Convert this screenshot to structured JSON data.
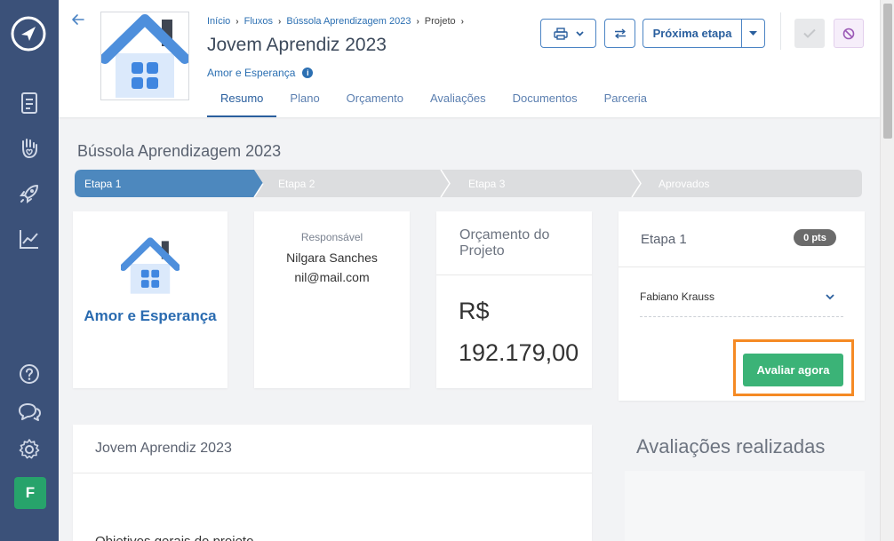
{
  "header": {
    "breadcrumb": [
      "Início",
      "Fluxos",
      "Bússola Aprendizagem 2023",
      "Projeto"
    ],
    "title": "Jovem Aprendiz 2023",
    "organization": "Amor e Esperança",
    "tabs": [
      "Resumo",
      "Plano",
      "Orçamento",
      "Avaliações",
      "Documentos",
      "Parceria"
    ],
    "active_tab": "Resumo",
    "next_step_label": "Próxima etapa"
  },
  "sidebar": {
    "items": [
      "logo-icon",
      "document-icon",
      "hand-heart-icon",
      "rocket-icon",
      "chart-icon",
      "help-icon",
      "chat-icon",
      "gear-icon"
    ],
    "avatar_initial": "F"
  },
  "flow": {
    "title": "Bússola Aprendizagem 2023",
    "steps": [
      "Etapa 1",
      "Etapa 2",
      "Etapa 3",
      "Aprovados"
    ],
    "active_step": "Etapa 1"
  },
  "cards": {
    "organization_name": "Amor e Esperança",
    "responsible_label": "Responsável",
    "responsible_name": "Nilgara Sanches",
    "responsible_email": "nil@mail.com",
    "budget_title": "Orçamento do Projeto",
    "budget_currency": "R$",
    "budget_amount": "192.179,00"
  },
  "evaluation": {
    "stage": "Etapa 1",
    "points": "0 pts",
    "evaluator": "Fabiano Krauss",
    "button_label": "Avaliar agora"
  },
  "project": {
    "title": "Jovem Aprendiz 2023",
    "partial_text": "Objetivos gerais do projeto"
  },
  "evaluations_done": {
    "title": "Avaliações realizadas"
  },
  "colors": {
    "sidebar": "#3b5179",
    "primary": "#2a5f9e",
    "active_step": "#4d88be",
    "success": "#3bb377",
    "highlight": "#f58a24"
  }
}
